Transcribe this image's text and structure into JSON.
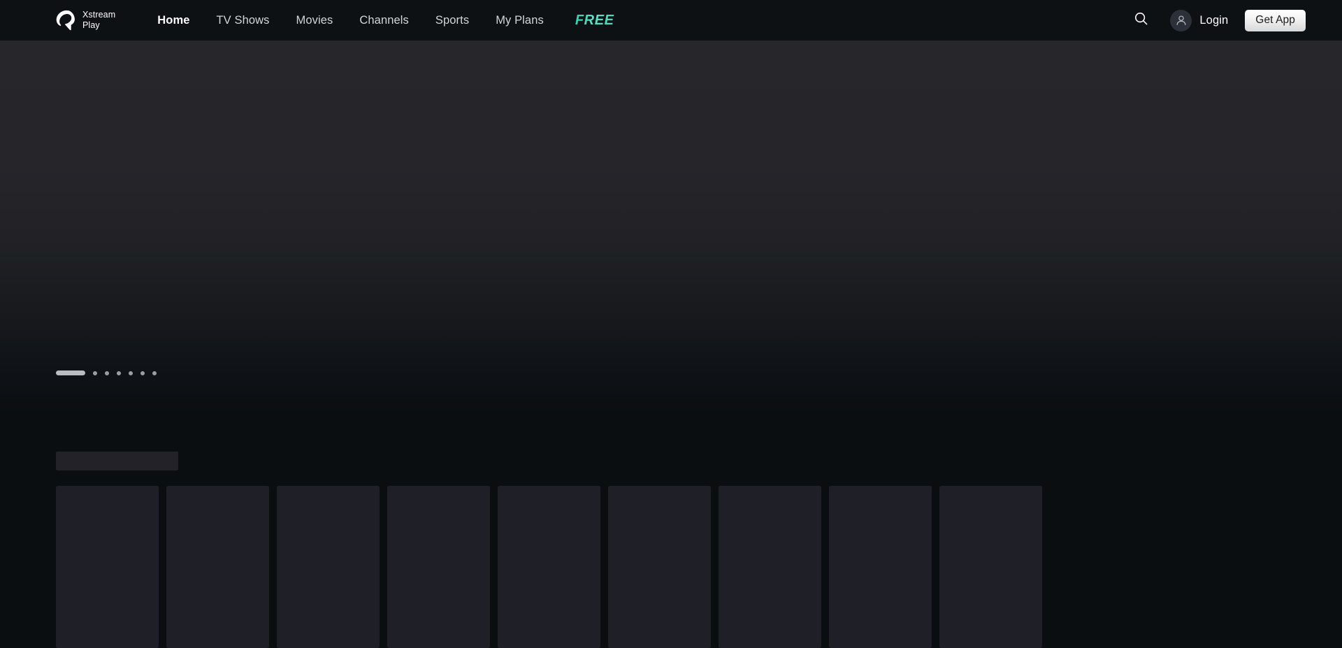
{
  "header": {
    "brand": {
      "name": "Xstream\nPlay",
      "logo_icon": "airtel-swoosh-logo"
    },
    "nav": [
      {
        "label": "Home",
        "active": true
      },
      {
        "label": "TV Shows",
        "active": false
      },
      {
        "label": "Movies",
        "active": false
      },
      {
        "label": "Channels",
        "active": false
      },
      {
        "label": "Sports",
        "active": false
      },
      {
        "label": "My Plans",
        "active": false
      }
    ],
    "free_badge": {
      "label": "FREE",
      "color": "#4fdcc0"
    },
    "search_icon": "search-icon",
    "account": {
      "avatar_icon": "user-avatar-icon",
      "login_label": "Login"
    },
    "get_app_label": "Get App",
    "background": "#0d1114"
  },
  "hero": {
    "state": "loading",
    "carousel_dots": {
      "total": 7,
      "active_index": 0
    }
  },
  "rail": {
    "state": "loading",
    "title_placeholder": "",
    "card_count": 9
  },
  "theme": {
    "page_background": "#0b0e11",
    "hero_background": "#26262b",
    "skeleton": "#1f2027",
    "accent": "#4fdcc0",
    "text_primary": "#ffffff",
    "text_secondary": "#d3d6d9"
  }
}
